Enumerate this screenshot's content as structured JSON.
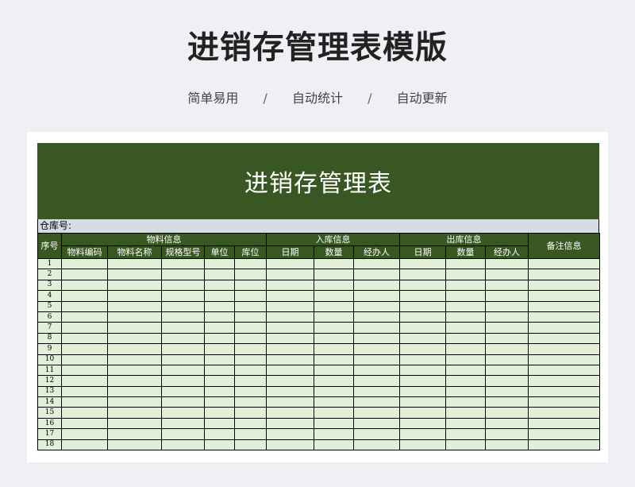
{
  "page": {
    "title": "进销存管理表模版",
    "taglines": [
      "简单易用",
      "自动统计",
      "自动更新"
    ],
    "separator": "/"
  },
  "sheet": {
    "title": "进销存管理表",
    "warehouse_label": "仓库号:",
    "header_groups": {
      "seq": "序号",
      "material": "物料信息",
      "inbound": "入库信息",
      "outbound": "出库信息",
      "remarks": "备注信息"
    },
    "material_columns": [
      "物料编码",
      "物料名称",
      "规格型号",
      "单位",
      "库位"
    ],
    "inbound_columns": [
      "日期",
      "数量",
      "经办人"
    ],
    "outbound_columns": [
      "日期",
      "数量",
      "经办人"
    ],
    "row_numbers": [
      "1",
      "2",
      "3",
      "4",
      "5",
      "6",
      "7",
      "8",
      "9",
      "10",
      "11",
      "12",
      "13",
      "14",
      "15",
      "16",
      "17",
      "18"
    ]
  },
  "colors": {
    "header_green": "#385723",
    "cell_green": "#e2efd9",
    "warehouse_bar": "#d6dce4"
  }
}
